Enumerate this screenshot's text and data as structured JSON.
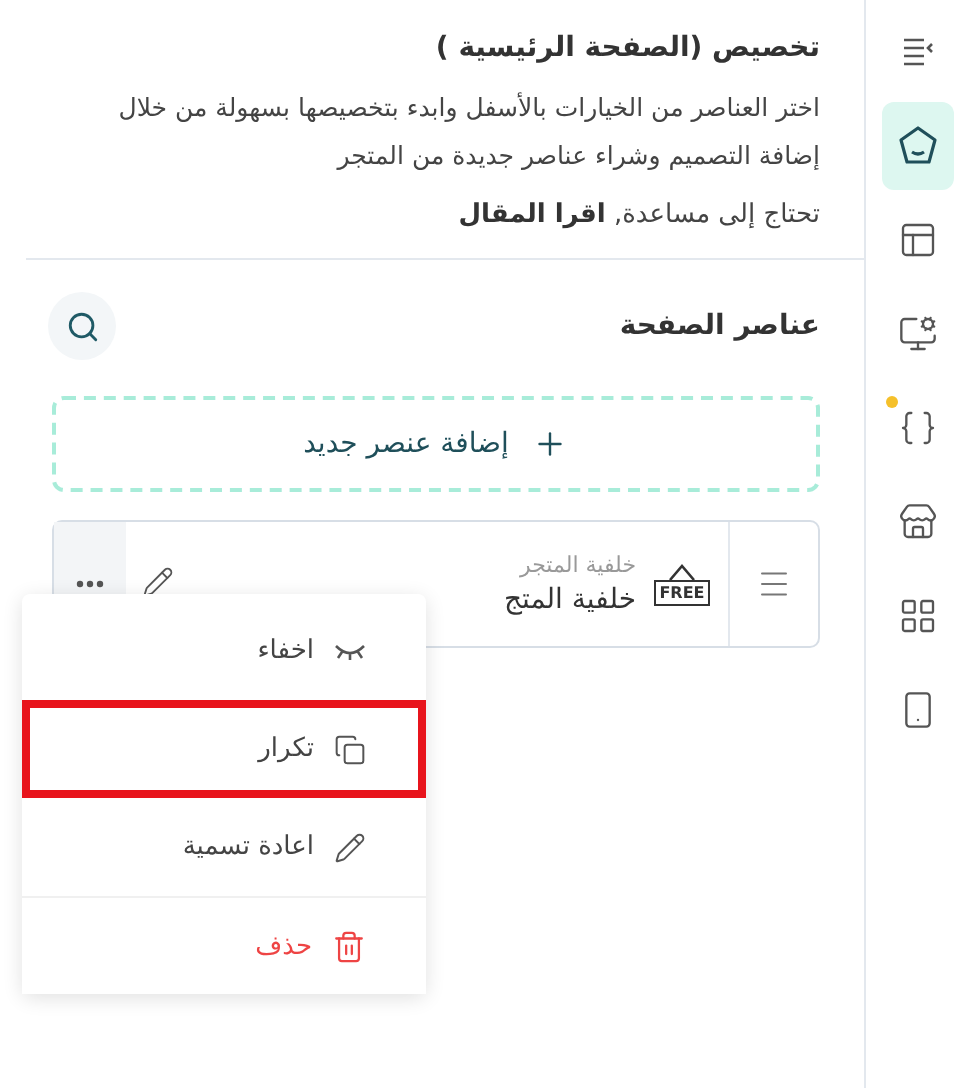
{
  "sidebar": {
    "items": [
      {
        "kind": "collapse",
        "selected": false,
        "dot": false
      },
      {
        "kind": "home",
        "selected": true,
        "dot": false
      },
      {
        "kind": "layout",
        "selected": false,
        "dot": false
      },
      {
        "kind": "monitor",
        "selected": false,
        "dot": false
      },
      {
        "kind": "code",
        "selected": false,
        "dot": true
      },
      {
        "kind": "store",
        "selected": false,
        "dot": false
      },
      {
        "kind": "grid",
        "selected": false,
        "dot": false
      },
      {
        "kind": "phone",
        "selected": false,
        "dot": false
      }
    ]
  },
  "header": {
    "title": "تخصيص (الصفحة الرئيسية )",
    "description": "اختر العناصر من الخيارات بالأسفل وابدء بتخصيصها بسهولة من خلال إضافة التصميم وشراء عناصر جديدة من المتجر",
    "help": "تحتاج إلى مساعدة,",
    "help_link": "اقرا المقال"
  },
  "elements": {
    "heading": "عناصر الصفحة",
    "add_button": "إضافة عنصر جديد",
    "items": [
      {
        "badge": "FREE",
        "subtitle": "خلفية المتجر",
        "title": "خلفية المتج"
      }
    ]
  },
  "context_menu": {
    "items": [
      {
        "kind": "hide",
        "label": "اخفاء",
        "highlighted": false
      },
      {
        "kind": "duplicate",
        "label": "تكرار",
        "highlighted": true
      },
      {
        "kind": "rename",
        "label": "اعادة تسمية",
        "highlighted": false
      },
      {
        "kind": "delete",
        "label": "حذف",
        "highlighted": false
      }
    ]
  }
}
